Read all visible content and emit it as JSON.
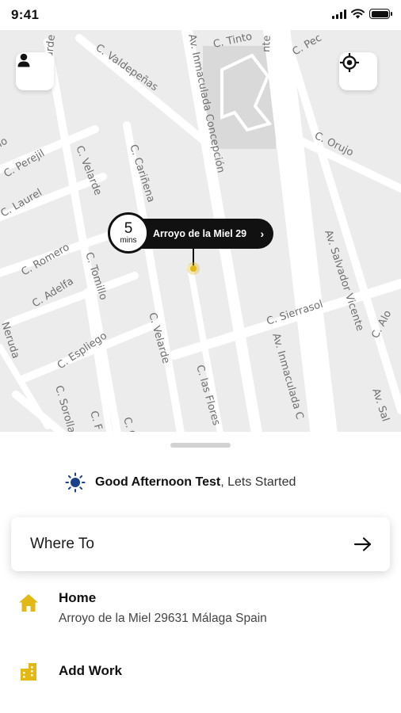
{
  "status": {
    "time": "9:41"
  },
  "map": {
    "streets": [
      "C. Velarde",
      "C. Valdepeñas",
      "Av. Inmaculada Concepción",
      "C. Tinto",
      "C. Pec",
      "nte",
      "C. Perejil",
      "C. Laurel",
      "no",
      "C. Velarde",
      "C. Cariñena",
      "C. Orujo",
      "C. Romero",
      "C. Adelfa",
      "C. Tomillo",
      "Av. Salvador Vicente",
      "C. Sierrasol",
      "C. Espliego",
      "C. Velarde",
      "Av. Inmaculada C",
      "C. las Flores",
      "C. Alo",
      "Neruda",
      "C. Sorolla",
      "C. F",
      "C. C",
      "Av. Sal"
    ]
  },
  "pin": {
    "eta_value": "5",
    "eta_unit": "mins",
    "address": "Arroyo de la Miel 29",
    "chevron": "›"
  },
  "greeting": {
    "name": "Good Afternoon Test",
    "suffix": ", Lets Started",
    "icon": "sun-icon",
    "icon_color": "#1d3f8a"
  },
  "search": {
    "label": "Where To",
    "icon": "arrow-right-icon"
  },
  "saved_places": {
    "home": {
      "title": "Home",
      "address": "Arroyo de la Miel 29631 Málaga Spain",
      "icon": "home-icon"
    },
    "work": {
      "title": "Add Work",
      "icon": "building-icon"
    }
  },
  "colors": {
    "accent": "#e2b914",
    "map_background": "#ececec",
    "road": "#ffffff",
    "pin": "#111111"
  }
}
